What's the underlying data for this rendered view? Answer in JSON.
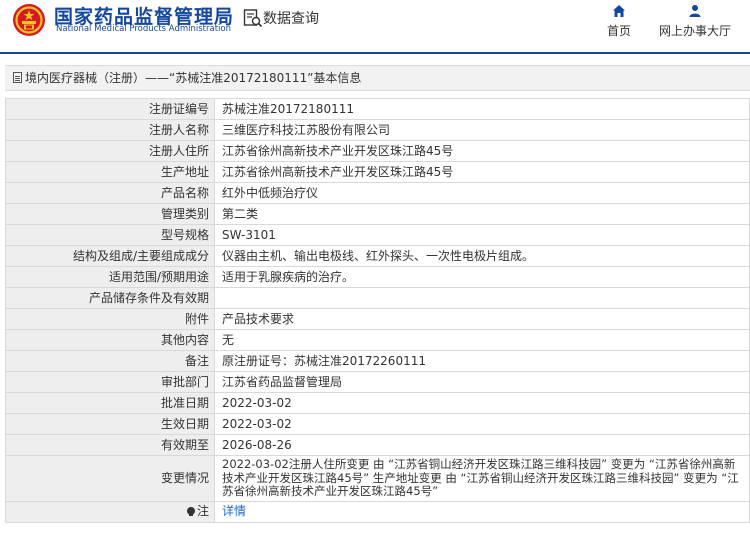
{
  "header": {
    "title_cn": "国家药品监督管理局",
    "title_en": "National Medical Products Administration",
    "search_label": "数据查询",
    "nav": {
      "home": "首页",
      "hall": "网上办事大厅"
    }
  },
  "breadcrumb": {
    "text": "境内医疗器械（注册）——“苏械注准20172180111”基本信息"
  },
  "rows": [
    {
      "label": "注册证编号",
      "value": "苏械注准20172180111"
    },
    {
      "label": "注册人名称",
      "value": "三维医疗科技江苏股份有限公司"
    },
    {
      "label": "注册人住所",
      "value": "江苏省徐州高新技术产业开发区珠江路45号"
    },
    {
      "label": "生产地址",
      "value": "江苏省徐州高新技术产业开发区珠江路45号"
    },
    {
      "label": "产品名称",
      "value": "红外中低频治疗仪"
    },
    {
      "label": "管理类别",
      "value": "第二类"
    },
    {
      "label": "型号规格",
      "value": "SW-3101"
    },
    {
      "label": "结构及组成/主要组成成分",
      "value": "仪器由主机、输出电极线、红外探头、一次性电极片组成。"
    },
    {
      "label": "适用范围/预期用途",
      "value": "适用于乳腺疾病的治疗。"
    },
    {
      "label": "产品储存条件及有效期",
      "value": ""
    },
    {
      "label": "附件",
      "value": "产品技术要求"
    },
    {
      "label": "其他内容",
      "value": "无"
    },
    {
      "label": "备注",
      "value": "原注册证号：苏械注准20172260111"
    },
    {
      "label": "审批部门",
      "value": "江苏省药品监督管理局"
    },
    {
      "label": "批准日期",
      "value": "2022-03-02"
    },
    {
      "label": "生效日期",
      "value": "2022-03-02"
    },
    {
      "label": "有效期至",
      "value": "2026-08-26"
    },
    {
      "label": "变更情况",
      "value": "2022-03-02注册人住所变更 由 “江苏省铜山经济开发区珠江路三维科技园” 变更为 “江苏省徐州高新技术产业开发区珠江路45号” 生产地址变更 由 “江苏省铜山经济开发区珠江路三维科技园” 变更为 “江苏省徐州高新技术产业开发区珠江路45号”"
    }
  ],
  "note": {
    "label": "注",
    "link": "详情"
  }
}
